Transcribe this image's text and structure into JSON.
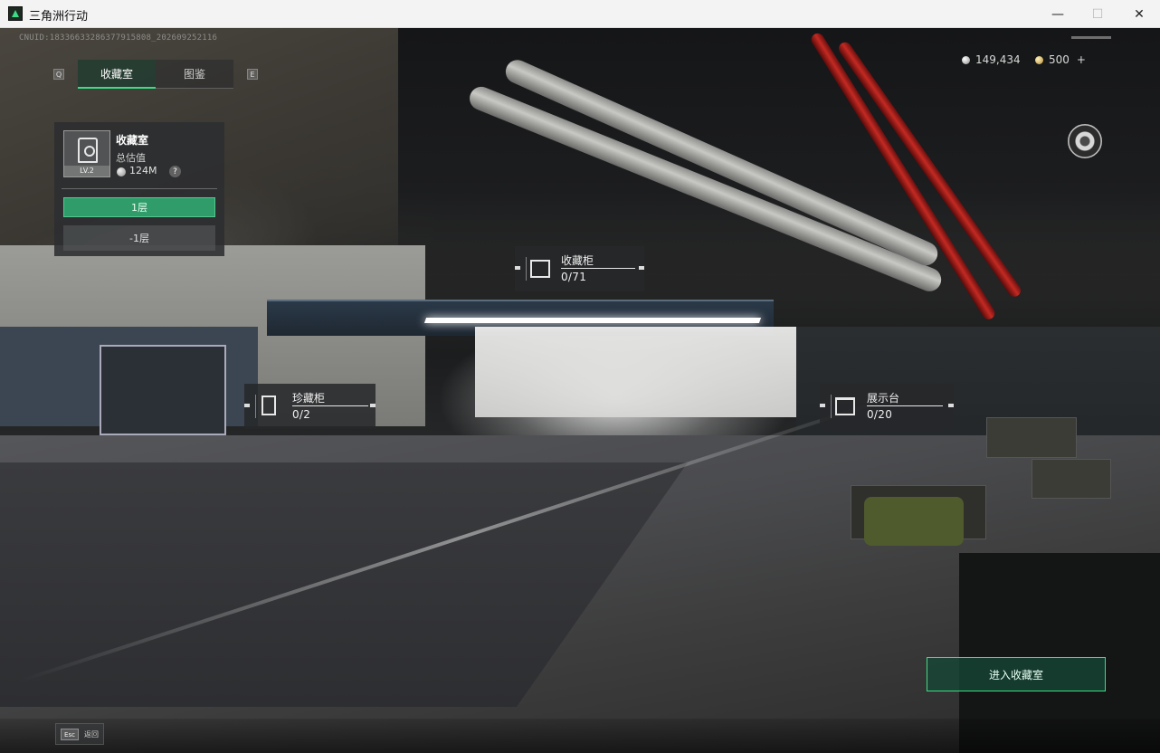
{
  "window": {
    "title": "三角洲行动",
    "minimize": "—",
    "maximize": "☐",
    "close": "✕"
  },
  "hud": {
    "cnuid": "CNUID:1833663328637791580​8_202609252116",
    "tab_key_left": "Q",
    "tab_key_right": "E",
    "tabs": [
      {
        "label": "收藏室",
        "active": true
      },
      {
        "label": "图鉴",
        "active": false
      }
    ]
  },
  "panel": {
    "title": "收藏室",
    "level": "LV.2",
    "value_label": "总估值",
    "value": "124M",
    "help": "?",
    "floors": [
      {
        "label": "1层",
        "active": true
      },
      {
        "label": "-1层",
        "active": false
      }
    ]
  },
  "currency": {
    "silver": "149,434",
    "gold": "500",
    "gold_add": "+"
  },
  "spots": [
    {
      "name": "收藏柜",
      "count": "0/71"
    },
    {
      "name": "珍藏柜",
      "count": "0/2"
    },
    {
      "name": "展示台",
      "count": "0/20"
    }
  ],
  "actions": {
    "enter": "进入收藏室",
    "esc_key": "Esc",
    "esc_label": "返回"
  },
  "colors": {
    "accent": "#3ddc84",
    "accent_dark": "#2f9c6a"
  },
  "icons": {
    "app": "delta-force-logo",
    "collection": "trophy-case-icon",
    "disc": "vinyl-disc-icon"
  }
}
